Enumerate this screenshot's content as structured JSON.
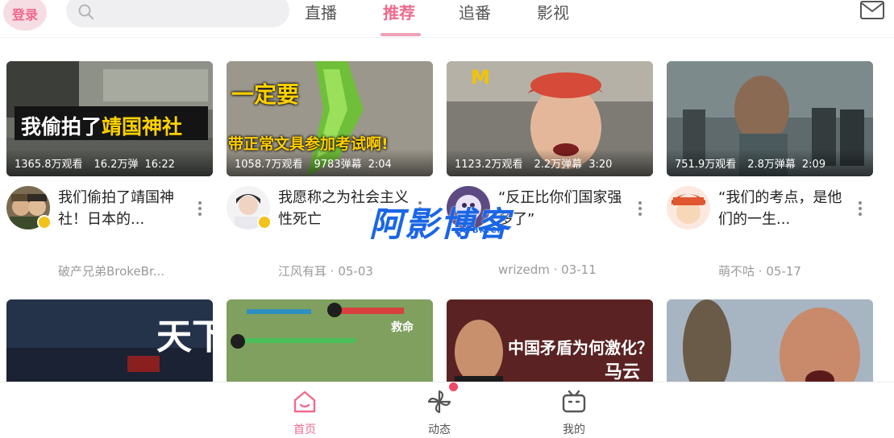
{
  "header": {
    "login_label": "登录",
    "search_placeholder": "",
    "tabs": [
      {
        "label": "直播",
        "active": false
      },
      {
        "label": "推荐",
        "active": true
      },
      {
        "label": "追番",
        "active": false
      },
      {
        "label": "影视",
        "active": false
      }
    ],
    "mail_icon": "mail-icon",
    "accent_color": "#f06a8d"
  },
  "feed": {
    "cards": [
      {
        "thumb_text": "我偷拍了靖国神社",
        "thumb_text_highlight": "靖国神社",
        "thumb_text_plain": "我偷拍了",
        "views": "1365.8万观看",
        "danmaku": "16.2万弹",
        "duration": "16:22",
        "title": "我们偷拍了靖国神社！日本的...",
        "author": "破产兄弟BrokeBr...",
        "date": ""
      },
      {
        "thumb_text_top": "一定要",
        "thumb_text_bottom": "带正常文具参加考试啊!",
        "views": "1058.7万观看",
        "danmaku": "9783弹幕",
        "duration": "2:04",
        "title": "我愿称之为社会主义性死亡",
        "author": "江风有耳",
        "date": "05-03"
      },
      {
        "views": "1123.2万观看",
        "danmaku": "2.2万弹幕",
        "duration": "3:20",
        "title": "“反正比你们国家强多了”",
        "author": "wrizedm",
        "date": "03-11"
      },
      {
        "views": "751.9万观看",
        "danmaku": "2.8万弹幕",
        "duration": "2:09",
        "title": "“我们的考点，是他们的一生...",
        "author": "萌不咕",
        "date": "05-17"
      }
    ],
    "second_row": [
      {
        "thumb_text": "天下"
      },
      {
        "thumb_text": "救命"
      },
      {
        "thumb_text": "中国矛盾为何激化？",
        "thumb_text_sub": "马云"
      },
      {
        "thumb_text": ""
      }
    ]
  },
  "watermark": {
    "main": "阿影博客",
    "sub": "AYBK.CN"
  },
  "bottom_nav": {
    "items": [
      {
        "label": "首页",
        "icon": "home-icon",
        "active": true
      },
      {
        "label": "动态",
        "icon": "pinwheel-icon",
        "active": false,
        "badge_dot": true
      },
      {
        "label": "我的",
        "icon": "tv-icon",
        "active": false
      }
    ]
  }
}
